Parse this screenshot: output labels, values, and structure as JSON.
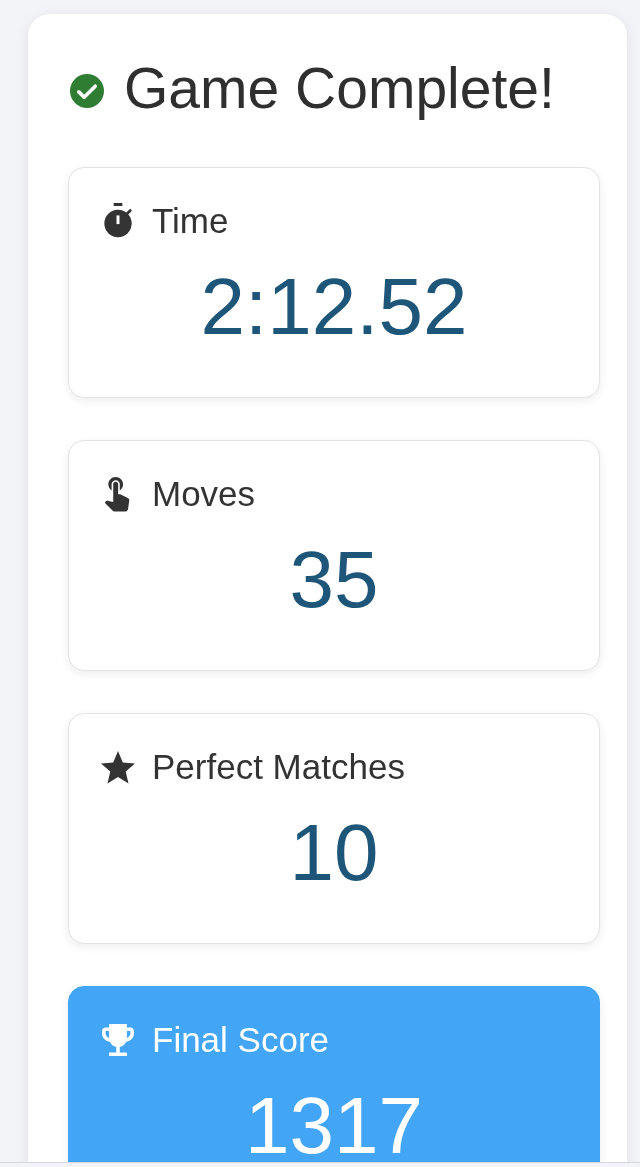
{
  "title": "Game Complete!",
  "stats": [
    {
      "kind": "time",
      "label": "Time",
      "value": "2:12.52"
    },
    {
      "kind": "moves",
      "label": "Moves",
      "value": "35"
    },
    {
      "kind": "matches",
      "label": "Perfect Matches",
      "value": "10"
    },
    {
      "kind": "score",
      "label": "Final Score",
      "value": "1317"
    }
  ]
}
